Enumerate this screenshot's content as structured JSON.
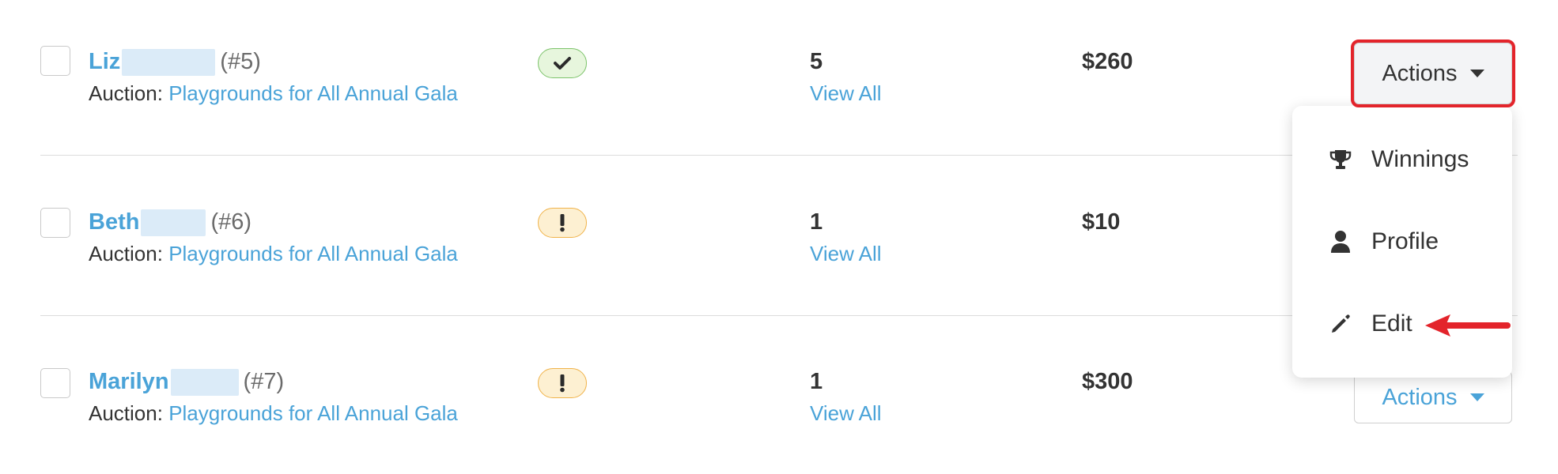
{
  "rows": [
    {
      "first_name": "Liz",
      "bidder_number": "(#5)",
      "auction_label": "Auction:",
      "auction_name": "Playgrounds for All Annual Gala",
      "status": "paid",
      "bid_count": "5",
      "view_all": "View All",
      "amount": "$260"
    },
    {
      "first_name": "Beth",
      "bidder_number": "(#6)",
      "auction_label": "Auction:",
      "auction_name": "Playgrounds for All Annual Gala",
      "status": "warning",
      "bid_count": "1",
      "view_all": "View All",
      "amount": "$10"
    },
    {
      "first_name": "Marilyn",
      "bidder_number": "(#7)",
      "auction_label": "Auction:",
      "auction_name": "Playgrounds for All Annual Gala",
      "status": "warning",
      "bid_count": "1",
      "view_all": "View All",
      "amount": "$300"
    }
  ],
  "actions": {
    "label": "Actions"
  },
  "dropdown": {
    "items": [
      {
        "label": "Winnings",
        "icon": "trophy-icon"
      },
      {
        "label": "Profile",
        "icon": "user-icon"
      },
      {
        "label": "Edit",
        "icon": "pencil-icon"
      }
    ]
  },
  "colors": {
    "link": "#4aa3d8",
    "highlight": "#e3242b",
    "success_badge": "#e7f6dd",
    "warning_badge": "#fdf0d2"
  }
}
